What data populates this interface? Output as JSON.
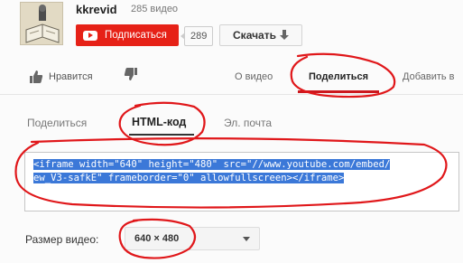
{
  "channel": {
    "name": "kkrevid",
    "video_count": "285 видео",
    "subscribe_label": "Подписаться",
    "subscriber_count": "289",
    "download_label": "Скачать"
  },
  "actions": {
    "like_label": "Нравится",
    "tabs": [
      "О видео",
      "Поделиться",
      "Добавить в"
    ],
    "active_tab": "Поделиться"
  },
  "share": {
    "subtabs": [
      "Поделиться",
      "HTML-код",
      "Эл. почта"
    ],
    "active_subtab": "HTML-код",
    "embed_code_line1": "<iframe width=\"640\" height=\"480\" src=\"//www.youtube.com/embed/",
    "embed_code_line2": "ew_V3-safkE\" frameborder=\"0\" allowfullscreen></iframe>",
    "video_size_label": "Размер видео:",
    "video_size_value": "640 × 480"
  },
  "colors": {
    "subscribe_red": "#e62117",
    "selection_blue": "#3b78d8",
    "annotation_red": "#e0171a"
  },
  "icons": [
    "thumbs-up-icon",
    "thumbs-down-icon",
    "youtube-logo-icon",
    "download-arrow-icon",
    "chevron-down-icon"
  ]
}
